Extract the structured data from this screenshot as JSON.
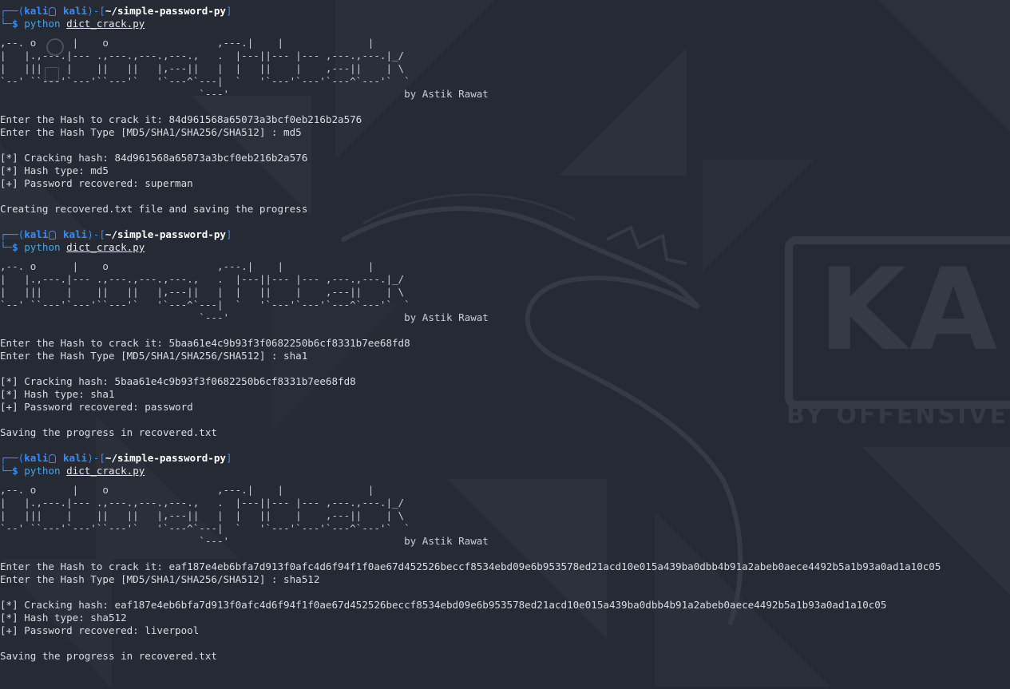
{
  "prompt": {
    "user": "kali",
    "host": "kali",
    "directory": "~/simple-password-py",
    "command": "python",
    "argument": "dict_crack.py"
  },
  "banner": {
    "lines": [
      ",--. o      |    o                  ,---.|    |              |     ",
      "|   |.,---.|--- .,---.,---.,---.,   .  |---||--- |--- ,---.,---.|_/  ",
      "|   |||    |    ||   ||   |,---||   |  |   ||    |    ,---||    | \\  ",
      "`--' ``---'`---'``---'`   '`---^`---|  `   '`---'`---'`---^`---'`  ` ",
      "                                 `---'                             by Astik Rawat"
    ]
  },
  "runs": [
    {
      "hash_prompt": "Enter the Hash to crack it: ",
      "hash": "84d961568a65073a3bcf0eb216b2a576",
      "type_prompt": "Enter the Hash Type [MD5/SHA1/SHA256/SHA512] : ",
      "type": "md5",
      "cracking": "[*] Cracking hash: 84d961568a65073a3bcf0eb216b2a576",
      "hash_type": "[*] Hash type: md5",
      "recovered": "[+] Password recovered: superman",
      "saving": "Creating recovered.txt file and saving the progress"
    },
    {
      "hash_prompt": "Enter the Hash to crack it: ",
      "hash": "5baa61e4c9b93f3f0682250b6cf8331b7ee68fd8",
      "type_prompt": "Enter the Hash Type [MD5/SHA1/SHA256/SHA512] : ",
      "type": "sha1",
      "cracking": "[*] Cracking hash: 5baa61e4c9b93f3f0682250b6cf8331b7ee68fd8",
      "hash_type": "[*] Hash type: sha1",
      "recovered": "[+] Password recovered: password",
      "saving": "Saving the progress in recovered.txt"
    },
    {
      "hash_prompt": "Enter the Hash to crack it: ",
      "hash": "eaf187e4eb6bfa7d913f0afc4d6f94f1f0ae67d452526beccf8534ebd09e6b953578ed21acd10e015a439ba0dbb4b91a2abeb0aece4492b5a1b93a0ad1a10c05",
      "type_prompt": "Enter the Hash Type [MD5/SHA1/SHA256/SHA512] : ",
      "type": "sha512",
      "cracking": "[*] Cracking hash: eaf187e4eb6bfa7d913f0afc4d6f94f1f0ae67d452526beccf8534ebd09e6b953578ed21acd10e015a439ba0dbb4b91a2abeb0aece4492b5a1b93a0ad1a10c05",
      "hash_type": "[*] Hash type: sha512",
      "recovered": "[+] Password recovered: liverpool",
      "saving": "Saving the progress in recovered.txt"
    }
  ],
  "wallpaper": {
    "logo_text": "KALI",
    "logo_subtitle": "BY OFFENSIVE SECURITY",
    "background_color": "#252a34",
    "accent_color": "#2f8ffc"
  }
}
